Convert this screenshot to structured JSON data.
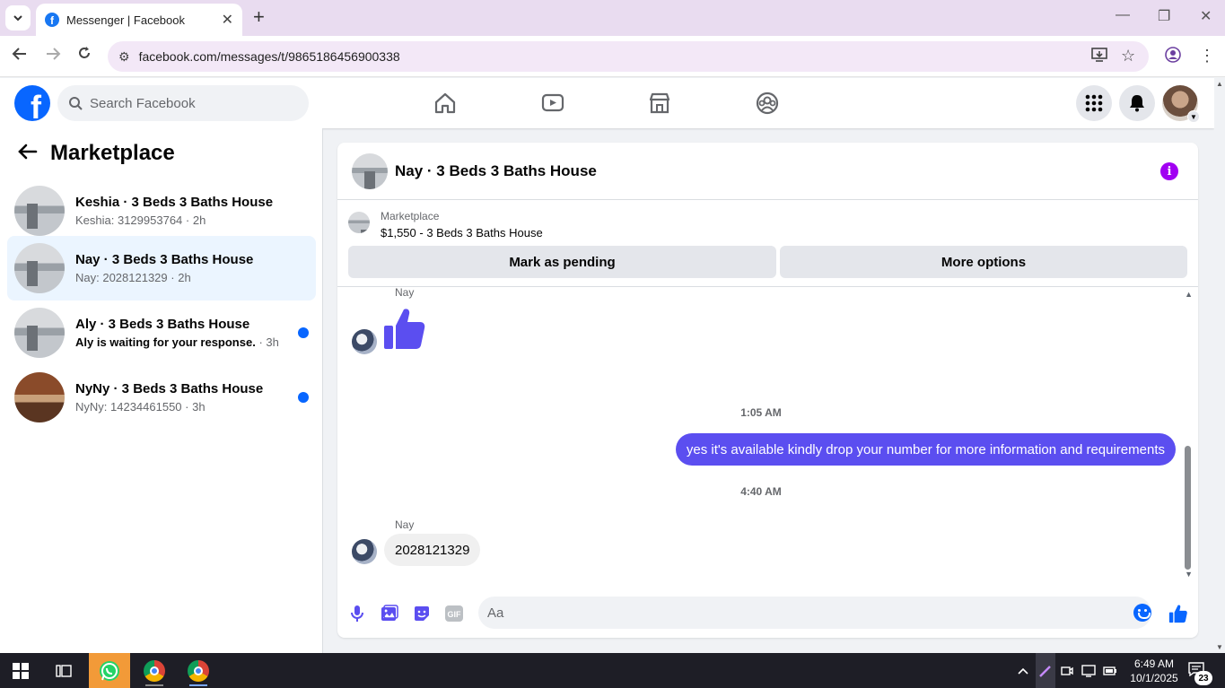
{
  "browser": {
    "tab_title": "Messenger | Facebook",
    "url": "facebook.com/messages/t/9865186456900338"
  },
  "fb": {
    "search_placeholder": "Search Facebook",
    "brand_color": "#0866ff"
  },
  "sidebar": {
    "title": "Marketplace",
    "conversations": [
      {
        "name": "Keshia · 3 Beds 3 Baths House",
        "preview": "Keshia: 3129953764",
        "time": "2h",
        "unread": false,
        "active": false
      },
      {
        "name": "Nay · 3 Beds 3 Baths House",
        "preview": "Nay: 2028121329",
        "time": "2h",
        "unread": false,
        "active": true
      },
      {
        "name": "Aly · 3 Beds 3 Baths House",
        "preview": "Aly is waiting for your response.",
        "time": "3h",
        "unread": true,
        "active": false
      },
      {
        "name": "NyNy · 3 Beds 3 Baths House",
        "preview": "NyNy: 14234461550",
        "time": "3h",
        "unread": true,
        "active": false
      }
    ]
  },
  "chat": {
    "title": "Nay · 3 Beds 3 Baths House",
    "listing_label": "Marketplace",
    "listing_name": "$1,550 - 3 Beds 3 Baths House",
    "mark_pending_label": "Mark as pending",
    "more_options_label": "More options",
    "messages": {
      "sender_1": "Nay",
      "time_1": "1:05 AM",
      "outgoing_1": "yes it's available kindly drop your number for more information and requirements",
      "time_2": "4:40 AM",
      "sender_2": "Nay",
      "incoming_1": "2028121329"
    },
    "composer_placeholder": "Aa",
    "outgoing_color": "#5b4ef0"
  },
  "taskbar": {
    "time": "6:49 AM",
    "date": "10/1/2025",
    "notification_count": "23"
  }
}
